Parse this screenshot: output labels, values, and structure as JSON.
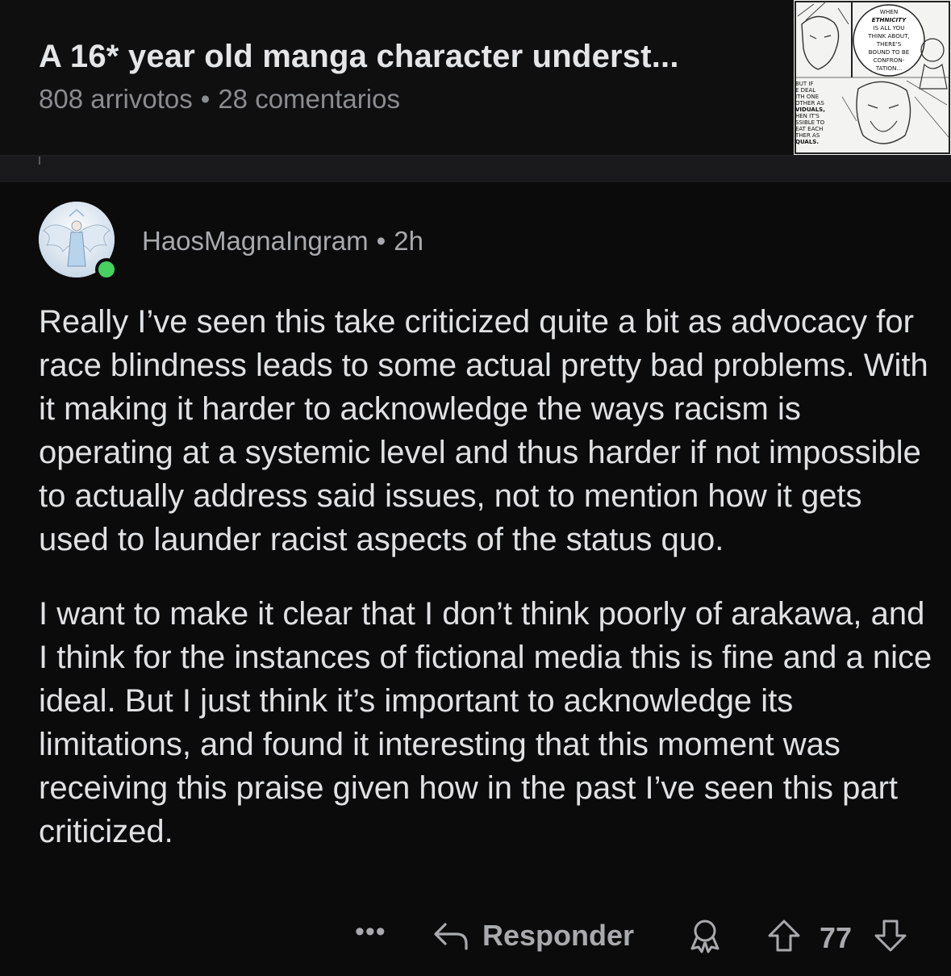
{
  "post": {
    "title": "A 16* year old manga character underst...",
    "upvotes": "808 arrivotos",
    "separator": "•",
    "comments": "28 comentarios",
    "thumbnail": {
      "icon": "manga-panel-thumbnail",
      "text_lines": [
        "WHEN",
        "ETHNICITY",
        "IS ALL YOU",
        "THINK ABOUT,",
        "THERE'S",
        "BOUND TO BE",
        "CONFRON-",
        "TATION..."
      ],
      "side_text_lines": [
        "BUT IF",
        "E DEAL",
        "ITH ONE",
        "OTHER AS",
        "VIDUALS,",
        "HEN IT'S",
        "SSIBLE TO",
        "EAT EACH",
        "THER AS",
        "QUALS."
      ]
    }
  },
  "comment": {
    "author": "HaosMagnaIngram",
    "separator": "•",
    "time": "2h",
    "online_status_color": "#46d160",
    "paragraphs": [
      "Really I’ve seen this take criticized quite a bit as advocacy for race blindness leads to some actual pretty bad problems. With it making it harder to acknowledge the ways racism is operating at a systemic level and thus harder if not impossible to actually address said issues, not to mention how it gets used to launder racist aspects of the status quo.",
      "I want to make it clear that I don’t think poorly of arakawa, and I think for the instances of fictional media this is fine and a nice ideal. But I just think it’s important to acknowledge its limitations, and found it interesting that this moment was receiving this praise given how in the past I’ve seen this part criticized."
    ]
  },
  "actions": {
    "more_label": "•••",
    "reply_label": "Responder",
    "vote_count": "77",
    "icons": {
      "more": "more-options-icon",
      "reply": "reply-arrow-icon",
      "award": "award-icon",
      "upvote": "upvote-arrow-icon",
      "downvote": "downvote-arrow-icon"
    }
  },
  "colors": {
    "background": "#0b0b0c",
    "header_background": "#0f0f10",
    "text_primary": "#dfe1e3",
    "text_secondary": "#8a8c8f"
  }
}
